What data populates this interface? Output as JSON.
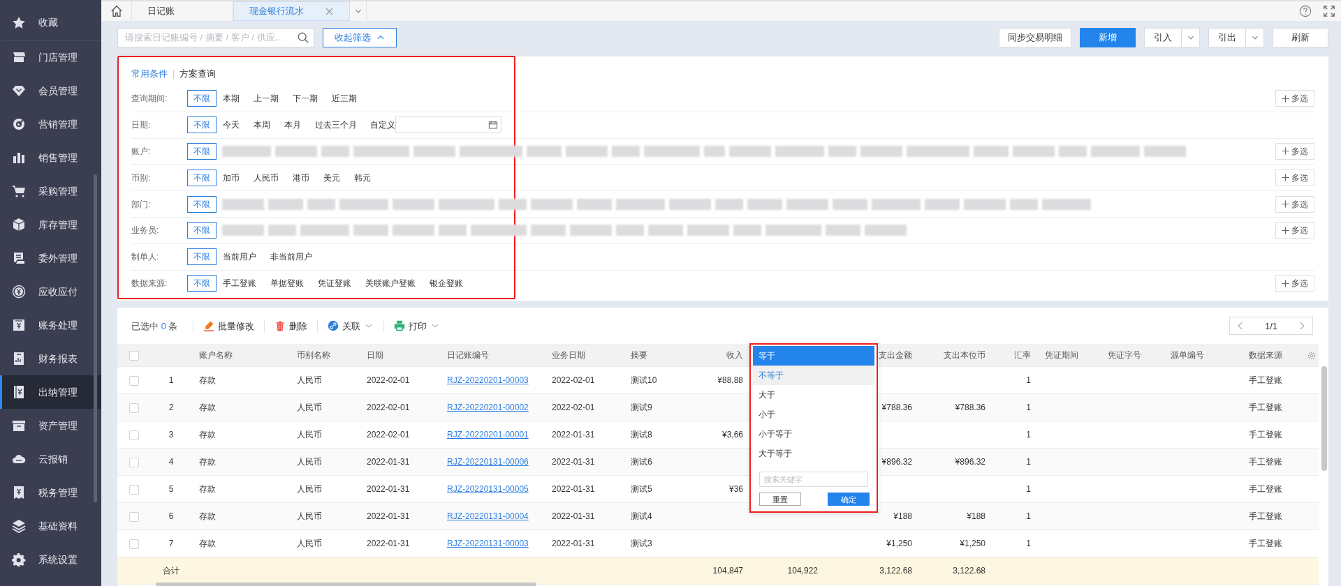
{
  "sidebar": {
    "items": [
      {
        "label": "收藏",
        "selected": false
      },
      {
        "label": "门店管理",
        "selected": false
      },
      {
        "label": "会员管理",
        "selected": false
      },
      {
        "label": "营销管理",
        "selected": false
      },
      {
        "label": "销售管理",
        "selected": false
      },
      {
        "label": "采购管理",
        "selected": false
      },
      {
        "label": "库存管理",
        "selected": false
      },
      {
        "label": "委外管理",
        "selected": false
      },
      {
        "label": "应收应付",
        "selected": false
      },
      {
        "label": "账务处理",
        "selected": false
      },
      {
        "label": "财务报表",
        "selected": false
      },
      {
        "label": "出纳管理",
        "selected": true
      },
      {
        "label": "资产管理",
        "selected": false
      },
      {
        "label": "云报销",
        "selected": false
      },
      {
        "label": "税务管理",
        "selected": false
      },
      {
        "label": "基础资料",
        "selected": false
      },
      {
        "label": "系统设置",
        "selected": false
      }
    ]
  },
  "tabs": [
    {
      "kind": "home",
      "selected": false
    },
    {
      "kind": "page",
      "label": "日记账",
      "selected": false,
      "closable": false
    },
    {
      "kind": "page",
      "label": "现金银行流水",
      "selected": true,
      "closable": true
    }
  ],
  "search": {
    "placeholder": "请搜索日记账编号 / 摘要 / 客户 / 供应..."
  },
  "collapse_button": {
    "label": "收起筛选"
  },
  "actions": [
    {
      "label": "同步交易明细",
      "kind": "plain"
    },
    {
      "label": "新增",
      "kind": "primary"
    },
    {
      "label": "引入",
      "kind": "split"
    },
    {
      "label": "引出",
      "kind": "split"
    },
    {
      "label": "刷新",
      "kind": "plain"
    }
  ],
  "filter_panel": {
    "highlighted": true,
    "modes": [
      {
        "label": "常用条件",
        "selected": true
      },
      {
        "label": "方案查询",
        "selected": false
      }
    ],
    "rows": [
      {
        "label": "查询期间:",
        "multi_select": "多选",
        "options": [
          {
            "label": "不限",
            "selected": true
          },
          {
            "label": "本期",
            "selected": false
          },
          {
            "label": "上一期",
            "selected": false
          },
          {
            "label": "下一期",
            "selected": false
          },
          {
            "label": "近三期",
            "selected": false
          }
        ]
      },
      {
        "label": "日期:",
        "options": [
          {
            "label": "不限",
            "selected": true
          },
          {
            "label": "今天",
            "selected": false
          },
          {
            "label": "本周",
            "selected": false
          },
          {
            "label": "本月",
            "selected": false
          },
          {
            "label": "过去三个月",
            "selected": false
          }
        ],
        "custom": {
          "label": "自定义"
        }
      },
      {
        "label": "账户:",
        "multi_select": "多选",
        "options": [
          {
            "label": "不限",
            "selected": true
          }
        ],
        "redacted": true
      },
      {
        "label": "币别:",
        "multi_select": "多选",
        "options": [
          {
            "label": "不限",
            "selected": true
          },
          {
            "label": "加币",
            "selected": false
          },
          {
            "label": "人民币",
            "selected": false
          },
          {
            "label": "港币",
            "selected": false
          },
          {
            "label": "美元",
            "selected": false
          },
          {
            "label": "韩元",
            "selected": false
          }
        ]
      },
      {
        "label": "部门:",
        "multi_select": "多选",
        "options": [
          {
            "label": "不限",
            "selected": true
          }
        ],
        "redacted": true
      },
      {
        "label": "业务员:",
        "multi_select": "多选",
        "options": [
          {
            "label": "不限",
            "selected": true
          }
        ],
        "redacted": true
      },
      {
        "label": "制单人:",
        "options": [
          {
            "label": "不限",
            "selected": true
          },
          {
            "label": "当前用户",
            "selected": false
          },
          {
            "label": "非当前用户",
            "selected": false
          }
        ]
      },
      {
        "label": "数据来源:",
        "multi_select": "多选",
        "options": [
          {
            "label": "不限",
            "selected": true
          },
          {
            "label": "手工登账",
            "selected": false
          },
          {
            "label": "单据登账",
            "selected": false
          },
          {
            "label": "凭证登账",
            "selected": false
          },
          {
            "label": "关联账户登账",
            "selected": false
          },
          {
            "label": "银企登账",
            "selected": false
          }
        ]
      }
    ]
  },
  "table_toolbar": {
    "selected_prefix": "已选中",
    "selected_count": "0",
    "selected_suffix": "条",
    "tools": [
      {
        "label": "批量修改",
        "kind": "edit",
        "has_menu": false
      },
      {
        "label": "删除",
        "kind": "delete",
        "has_menu": false
      },
      {
        "label": "关联",
        "kind": "link",
        "has_menu": true
      },
      {
        "label": "打印",
        "kind": "print",
        "has_menu": true
      }
    ],
    "pager": "1/1"
  },
  "table": {
    "all_checked": false,
    "columns": [
      "账户名称",
      "币别名称",
      "日期",
      "日记账编号",
      "业务日期",
      "摘要",
      "收入",
      "支出金额",
      "支出本位币",
      "汇率",
      "凭证期间",
      "凭证字号",
      "源单编号",
      "数据来源"
    ],
    "rows": [
      {
        "checked": false,
        "index": "1",
        "account": "存款",
        "currency": "人民币",
        "date": "2022-02-01",
        "journal_no": "RJZ-20220201-00003",
        "business_date": "2022-02-01",
        "memo": "测试10",
        "income": "¥88,88",
        "rate": "1",
        "source": "手工登账"
      },
      {
        "checked": false,
        "index": "2",
        "account": "存款",
        "currency": "人民币",
        "date": "2022-02-01",
        "journal_no": "RJZ-20220201-00002",
        "business_date": "2022-02-01",
        "memo": "测试9",
        "expense": "¥788.36",
        "expense_base": "¥788.36",
        "rate": "1",
        "source": "手工登账"
      },
      {
        "checked": false,
        "index": "3",
        "account": "存款",
        "currency": "人民币",
        "date": "2022-02-01",
        "journal_no": "RJZ-20220201-00001",
        "business_date": "2022-01-31",
        "memo": "测试8",
        "income": "¥3,66",
        "rate": "1",
        "source": "手工登账"
      },
      {
        "checked": false,
        "index": "4",
        "account": "存款",
        "currency": "人民币",
        "date": "2022-01-31",
        "journal_no": "RJZ-20220131-00006",
        "business_date": "2022-01-31",
        "memo": "测试6",
        "expense": "¥896.32",
        "expense_base": "¥896.32",
        "rate": "1",
        "source": "手工登账"
      },
      {
        "checked": false,
        "index": "5",
        "account": "存款",
        "currency": "人民币",
        "date": "2022-01-31",
        "journal_no": "RJZ-20220131-00005",
        "business_date": "2022-01-31",
        "memo": "测试5",
        "income": "¥36",
        "rate": "1",
        "source": "手工登账"
      },
      {
        "checked": false,
        "index": "6",
        "account": "存款",
        "currency": "人民币",
        "date": "2022-01-31",
        "journal_no": "RJZ-20220131-00004",
        "business_date": "2022-01-31",
        "memo": "测试4",
        "expense": "¥188",
        "expense_base": "¥188",
        "rate": "1",
        "source": "手工登账"
      },
      {
        "checked": false,
        "index": "7",
        "account": "存款",
        "currency": "人民币",
        "date": "2022-01-31",
        "journal_no": "RJZ-20220131-00003",
        "business_date": "2022-01-31",
        "memo": "测试3",
        "expense": "¥1,250",
        "expense_base": "¥1,250",
        "rate": "1",
        "source": "手工登账"
      }
    ],
    "totals": {
      "label": "合计",
      "income": "104,847",
      "income_base": "104,922",
      "expense": "3,122.68",
      "expense_base": "3,122.68"
    }
  },
  "condition_dropdown": {
    "highlighted": true,
    "options": [
      {
        "label": "等于",
        "selected": true,
        "hovered": false
      },
      {
        "label": "不等于",
        "selected": false,
        "hovered": true
      },
      {
        "label": "大于",
        "selected": false,
        "hovered": false
      },
      {
        "label": "小于",
        "selected": false,
        "hovered": false
      },
      {
        "label": "小于等于",
        "selected": false,
        "hovered": false
      },
      {
        "label": "大于等于",
        "selected": false,
        "hovered": false
      }
    ],
    "search": {
      "placeholder": "搜索关键字"
    },
    "buttons": [
      {
        "label": "重置",
        "primary": false
      },
      {
        "label": "确定",
        "primary": true
      }
    ]
  }
}
